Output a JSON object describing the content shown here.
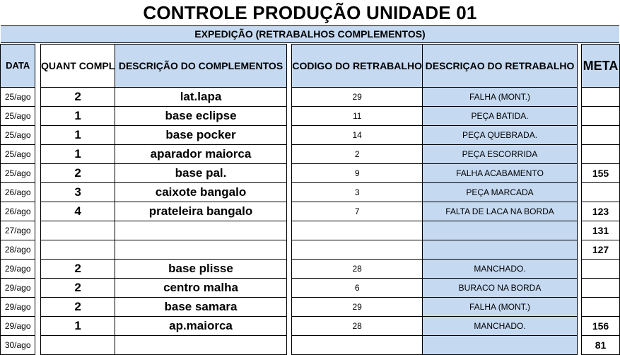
{
  "sheet": {
    "title": "CONTROLE PRODUÇÃO UNIDADE 01",
    "subtitle": "EXPEDIÇÃO (RETRABALHOS COMPLEMENTOS)",
    "colors": {
      "header_blue": "#c5d9f1",
      "grid": "#000000"
    }
  },
  "headers": {
    "date": "DATA",
    "qty": "QUANT COMPL",
    "desc": "DESCRIÇÃO DO COMPLEMENTOS",
    "code": "CODIGO DO RETRABALHO",
    "rework": "DESCRIÇAO DO RETRABALHO",
    "meta": "META"
  },
  "rows": [
    {
      "date": "25/ago",
      "qty": "2",
      "desc": "lat.lapa",
      "code": "29",
      "rework": "FALHA (MONT.)",
      "meta": ""
    },
    {
      "date": "25/ago",
      "qty": "1",
      "desc": "base eclipse",
      "code": "11",
      "rework": "PEÇA BATIDA.",
      "meta": ""
    },
    {
      "date": "25/ago",
      "qty": "1",
      "desc": "base pocker",
      "code": "14",
      "rework": "PEÇA QUEBRADA.",
      "meta": ""
    },
    {
      "date": "25/ago",
      "qty": "1",
      "desc": "aparador maiorca",
      "code": "2",
      "rework": "PEÇA ESCORRIDA",
      "meta": ""
    },
    {
      "date": "25/ago",
      "qty": "2",
      "desc": "base pal.",
      "code": "9",
      "rework": "FALHA ACABAMENTO",
      "meta": "155"
    },
    {
      "date": "26/ago",
      "qty": "3",
      "desc": "caixote bangalo",
      "code": "3",
      "rework": "PEÇA MARCADA",
      "meta": ""
    },
    {
      "date": "26/ago",
      "qty": "4",
      "desc": "prateleira bangalo",
      "code": "7",
      "rework": "FALTA DE LACA NA BORDA",
      "meta": "123"
    },
    {
      "date": "27/ago",
      "qty": "",
      "desc": "",
      "code": "",
      "rework": "",
      "meta": "131"
    },
    {
      "date": "28/ago",
      "qty": "",
      "desc": "",
      "code": "",
      "rework": "",
      "meta": "127"
    },
    {
      "date": "29/ago",
      "qty": "2",
      "desc": "base plisse",
      "code": "28",
      "rework": "MANCHADO.",
      "meta": ""
    },
    {
      "date": "29/ago",
      "qty": "2",
      "desc": "centro malha",
      "code": "6",
      "rework": "BURACO NA BORDA",
      "meta": ""
    },
    {
      "date": "29/ago",
      "qty": "2",
      "desc": "base samara",
      "code": "29",
      "rework": "FALHA (MONT.)",
      "meta": ""
    },
    {
      "date": "29/ago",
      "qty": "1",
      "desc": "ap.maiorca",
      "code": "28",
      "rework": "MANCHADO.",
      "meta": "156"
    },
    {
      "date": "30/ago",
      "qty": "",
      "desc": "",
      "code": "",
      "rework": "",
      "meta": "81"
    }
  ]
}
